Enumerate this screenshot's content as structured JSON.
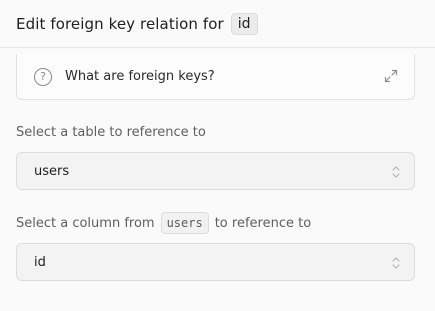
{
  "header": {
    "title": "Edit foreign key relation for",
    "column_chip": "id"
  },
  "info": {
    "label": "What are foreign keys?",
    "icons": [
      "question-circle-icon",
      "expand-icon"
    ]
  },
  "table_field": {
    "label": "Select a table to reference to",
    "value": "users"
  },
  "column_field": {
    "label_prefix": "Select a column from",
    "label_chip": "users",
    "label_suffix": "to reference to",
    "value": "id"
  }
}
